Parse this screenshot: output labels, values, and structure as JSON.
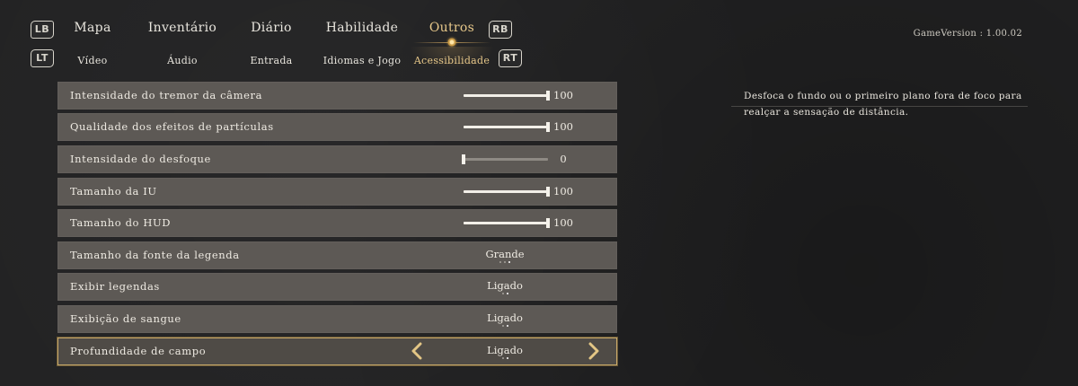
{
  "header": {
    "badges": {
      "lb": "LB",
      "rb": "RB",
      "lt": "LT",
      "rt": "RT"
    },
    "main_tabs": [
      "Mapa",
      "Inventário",
      "Diário",
      "Habilidade",
      "Outros"
    ],
    "active_main_tab": "Outros",
    "sub_tabs": [
      "Vídeo",
      "Áudio",
      "Entrada",
      "Idiomas e Jogo",
      "Acessibilidade"
    ],
    "active_sub_tab": "Acessibilidade",
    "version": "GameVersion : 1.00.02"
  },
  "settings": [
    {
      "label": "Intensidade do tremor da câmera",
      "type": "slider",
      "value": "100",
      "level": 1.0
    },
    {
      "label": "Qualidade dos efeitos de partículas",
      "type": "slider",
      "value": "100",
      "level": 1.0
    },
    {
      "label": "Intensidade do desfoque",
      "type": "slider",
      "value": "0",
      "level": 0.0
    },
    {
      "label": "Tamanho da IU",
      "type": "slider",
      "value": "100",
      "level": 1.0
    },
    {
      "label": "Tamanho do HUD",
      "type": "slider",
      "value": "100",
      "level": 1.0
    },
    {
      "label": "Tamanho da fonte da legenda",
      "type": "option",
      "value": "Grande",
      "option_count": 3,
      "option_index": 2
    },
    {
      "label": "Exibir legendas",
      "type": "option",
      "value": "Ligado",
      "option_count": 2,
      "option_index": 1
    },
    {
      "label": "Exibição de sangue",
      "type": "option",
      "value": "Ligado",
      "option_count": 2,
      "option_index": 1
    },
    {
      "label": "Profundidade de campo",
      "type": "option",
      "value": "Ligado",
      "option_count": 2,
      "option_index": 1,
      "selected": true
    }
  ],
  "description": "Desfoca o fundo ou o primeiro plano fora de foco para realçar a sensação de distância.",
  "colors": {
    "accent": "#e7c88a",
    "row": "#5d5955",
    "selected_border": "#c7a86a"
  }
}
